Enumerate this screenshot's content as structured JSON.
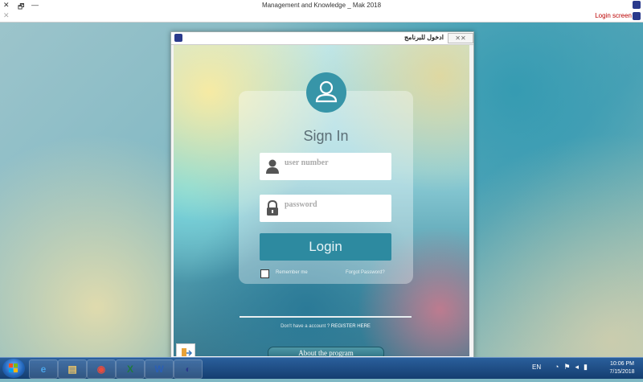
{
  "app": {
    "title": "Management and Knowledge _ Mak 2018",
    "controls": {
      "close": "✕",
      "restore": "🗗",
      "minimize": "—"
    },
    "strip_close": "✕",
    "screen_label": "Login screen"
  },
  "dialog": {
    "title": "ادخول للبرنامج",
    "close_label": "✕✕",
    "sign_in": "Sign In",
    "user_placeholder": "user number",
    "password_placeholder": "password",
    "login_label": "Login",
    "remember_label": "Remember me",
    "forgot_label": "Forgot Password?",
    "no_account": "Don't have a account ?",
    "register": "REGISTER HERE",
    "about": "About the program"
  },
  "taskbar": {
    "apps": [
      {
        "name": "internet-explorer",
        "glyph": "e",
        "color": "#4aa3e8"
      },
      {
        "name": "file-explorer",
        "glyph": "▤",
        "color": "#e8c36a"
      },
      {
        "name": "chrome",
        "glyph": "◉",
        "color": "#e84c3d"
      },
      {
        "name": "excel",
        "glyph": "X",
        "color": "#1f7a3e"
      },
      {
        "name": "word",
        "glyph": "W",
        "color": "#2b5fb5"
      },
      {
        "name": "mak-app",
        "glyph": "◐",
        "color": "#2a3a8c"
      }
    ],
    "lang": "EN",
    "time": "10:06 PM",
    "date": "7/15/2018"
  }
}
